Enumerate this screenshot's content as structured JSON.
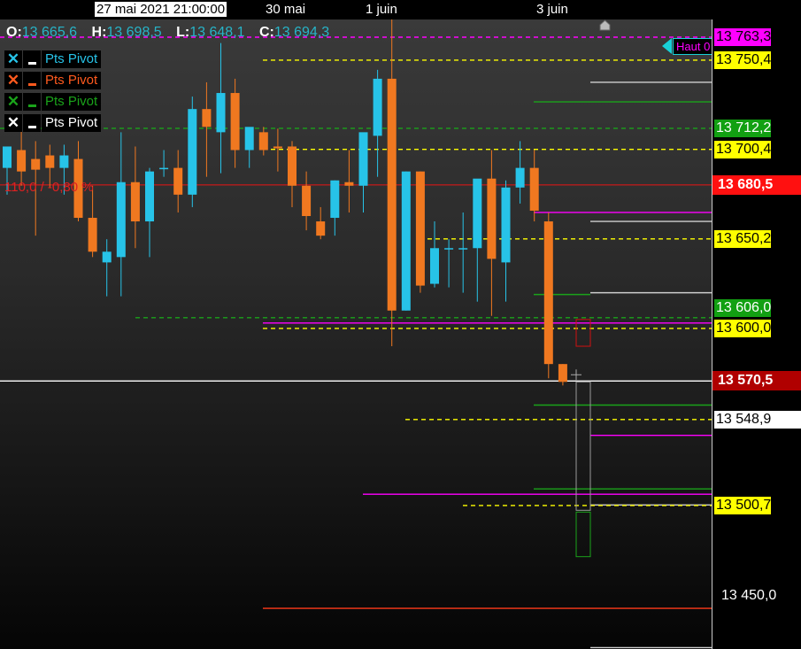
{
  "time_axis": {
    "cursor_time": "27 mai 2021 21:00:00",
    "labels": [
      "30 mai",
      "1 juin",
      "3 juin"
    ]
  },
  "ohlc": {
    "o_label": "O:",
    "o": "13 665,6",
    "h_label": "H:",
    "h": "13 698,5",
    "l_label": "L:",
    "l": "13 648,1",
    "c_label": "C:",
    "c": "13 694,3"
  },
  "legend": [
    {
      "label": "Pts Pivot",
      "color": "#27c3e8"
    },
    {
      "label": "Pts Pivot",
      "color": "#ff5a1e"
    },
    {
      "label": "Pts Pivot",
      "color": "#1aa31a"
    },
    {
      "label": "Pts Pivot",
      "color": "#ffffff"
    }
  ],
  "indicator_text": "110,0 / -0,80 %",
  "haut_label": "Haut 0",
  "price_tags": [
    {
      "text": "13 763,3",
      "bg": "#ff00ff",
      "fg": "#000000"
    },
    {
      "text": "13 750,4",
      "bg": "#ffff00",
      "fg": "#000000"
    },
    {
      "text": "13 712,2",
      "bg": "#12a012",
      "fg": "#ffffff"
    },
    {
      "text": "13 700,4",
      "bg": "#ffff00",
      "fg": "#000000"
    },
    {
      "text": "13 680,5",
      "bg": "#ff1010",
      "fg": "#ffffff"
    },
    {
      "text": "13 650,2",
      "bg": "#ffff00",
      "fg": "#000000"
    },
    {
      "text": "13 606,0",
      "bg": "#12a012",
      "fg": "#ffffff"
    },
    {
      "text": "13 600,0",
      "bg": "#ffff00",
      "fg": "#000000"
    },
    {
      "text": "13 570,5",
      "bg": "#b00000",
      "fg": "#ffffff"
    },
    {
      "text": "13 548,9",
      "bg": "#ffffff",
      "fg": "#000000"
    },
    {
      "text": "13 500,7",
      "bg": "#ffff00",
      "fg": "#000000"
    },
    {
      "text": "13 450,0",
      "bg": "#000000",
      "fg": "#ffffff"
    }
  ],
  "colors": {
    "bull": "#27c3e8",
    "bear": "#f07820",
    "pivot_yellow": "#ffff00",
    "pivot_green": "#1aa31a",
    "pivot_magenta": "#ff00ff",
    "crosshair": "#ffffff"
  },
  "chart_data": {
    "type": "candlestick",
    "ylabel": "",
    "ylim": [
      13420,
      13780
    ],
    "candles": [
      {
        "o": 13690,
        "h": 13698,
        "l": 13675,
        "c": 13702
      },
      {
        "o": 13700,
        "h": 13712,
        "l": 13680,
        "c": 13688
      },
      {
        "o": 13695,
        "h": 13705,
        "l": 13652,
        "c": 13689
      },
      {
        "o": 13697,
        "h": 13703,
        "l": 13679,
        "c": 13690
      },
      {
        "o": 13690,
        "h": 13703,
        "l": 13675,
        "c": 13697
      },
      {
        "o": 13695,
        "h": 13705,
        "l": 13660,
        "c": 13662
      },
      {
        "o": 13662,
        "h": 13680,
        "l": 13640,
        "c": 13643
      },
      {
        "o": 13637,
        "h": 13650,
        "l": 13618,
        "c": 13643
      },
      {
        "o": 13640,
        "h": 13710,
        "l": 13618,
        "c": 13682
      },
      {
        "o": 13682,
        "h": 13702,
        "l": 13645,
        "c": 13660
      },
      {
        "o": 13660,
        "h": 13690,
        "l": 13640,
        "c": 13688
      },
      {
        "o": 13690,
        "h": 13700,
        "l": 13685,
        "c": 13690
      },
      {
        "o": 13690,
        "h": 13700,
        "l": 13665,
        "c": 13675
      },
      {
        "o": 13675,
        "h": 13730,
        "l": 13668,
        "c": 13723
      },
      {
        "o": 13723,
        "h": 13738,
        "l": 13685,
        "c": 13713
      },
      {
        "o": 13710,
        "h": 13760,
        "l": 13687,
        "c": 13732
      },
      {
        "o": 13732,
        "h": 13740,
        "l": 13690,
        "c": 13700
      },
      {
        "o": 13700,
        "h": 13710,
        "l": 13690,
        "c": 13713
      },
      {
        "o": 13710,
        "h": 13713,
        "l": 13697,
        "c": 13700
      },
      {
        "o": 13702,
        "h": 13712,
        "l": 13688,
        "c": 13701
      },
      {
        "o": 13702,
        "h": 13705,
        "l": 13668,
        "c": 13680
      },
      {
        "o": 13680,
        "h": 13688,
        "l": 13655,
        "c": 13663
      },
      {
        "o": 13660,
        "h": 13668,
        "l": 13650,
        "c": 13652
      },
      {
        "o": 13662,
        "h": 13683,
        "l": 13652,
        "c": 13683
      },
      {
        "o": 13682,
        "h": 13700,
        "l": 13665,
        "c": 13680
      },
      {
        "o": 13680,
        "h": 13700,
        "l": 13665,
        "c": 13710
      },
      {
        "o": 13708,
        "h": 13745,
        "l": 13685,
        "c": 13740
      },
      {
        "o": 13740,
        "h": 13790,
        "l": 13590,
        "c": 13610
      },
      {
        "o": 13610,
        "h": 13688,
        "l": 13610,
        "c": 13688
      },
      {
        "o": 13688,
        "h": 13688,
        "l": 13620,
        "c": 13624
      },
      {
        "o": 13625,
        "h": 13660,
        "l": 13623,
        "c": 13645
      },
      {
        "o": 13645,
        "h": 13650,
        "l": 13623,
        "c": 13645
      },
      {
        "o": 13645,
        "h": 13665,
        "l": 13620,
        "c": 13645
      },
      {
        "o": 13645,
        "h": 13665,
        "l": 13615,
        "c": 13684
      },
      {
        "o": 13684,
        "h": 13700,
        "l": 13607,
        "c": 13639
      },
      {
        "o": 13637,
        "h": 13683,
        "l": 13615,
        "c": 13679
      },
      {
        "o": 13679,
        "h": 13705,
        "l": 13670,
        "c": 13690
      },
      {
        "o": 13690,
        "h": 13700,
        "l": 13660,
        "c": 13666
      },
      {
        "o": 13660,
        "h": 13665,
        "l": 13572,
        "c": 13580
      },
      {
        "o": 13580,
        "h": 13580,
        "l": 13568,
        "c": 13570
      }
    ],
    "pivot_levels": [
      13763.3,
      13750.4,
      13712.2,
      13700.4,
      13650.2,
      13606.0,
      13600.0,
      13548.9,
      13500.7
    ],
    "last_price": 13570.5,
    "cursor_price": 13680.5
  }
}
